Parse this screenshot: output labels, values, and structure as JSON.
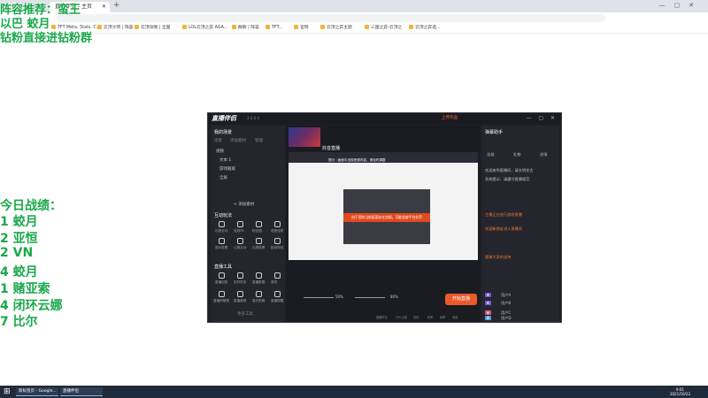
{
  "overlay": {
    "lineup_label": "阵容推荐：蛮王",
    "line2": "以巴 蛟月",
    "line3": "钻粉直接进钻粉群",
    "stats_title": "今日战绩：",
    "stats": [
      "1 蛟月",
      "2 亚恒",
      "2 VN",
      "4 蛟月",
      "1 赌亚索",
      "4 闭环云娜",
      "7 比尔"
    ]
  },
  "browser": {
    "tab_title": "直播伴侣 - 主页",
    "new_tab": "+",
    "window_controls": "—▢✕",
    "url": "",
    "bookmarks": [
      "TFT Meta, Stats, C...",
      "云顶大师 | 阵容",
      "云顶攻略 | 全国",
      "LOL云顶之弈 AGA...",
      "群聊 | 阵容",
      "TFT...",
      "官网",
      "云顶之弈主题",
      "三国之弈-云顶之",
      "云顶之弈选..."
    ]
  },
  "app": {
    "logo": "直播伴侣",
    "version": "3.5.0.0",
    "upload_badge": "上传作品",
    "window_controls": "— ▢ ✕",
    "left_panel": {
      "scene_header": "我的场景",
      "tabs": [
        "场景",
        "添加素材",
        "管理"
      ],
      "source_label": "添加素材",
      "sources": [
        "视频",
        "文本 1",
        "游戏截取",
        "全屏"
      ],
      "add_source_button": "+ 添加素材",
      "interact_header": "互动玩法",
      "interact_tools": [
        "礼物互动",
        "连线PK",
        "粉丝团",
        "语音连麦",
        "观众投票",
        "公屏互动",
        "礼物投票",
        "贴纸特效"
      ],
      "live_tools_header": "直播工具",
      "live_tools": [
        "直播回放",
        "定时任务",
        "直播数据",
        "音效",
        "直播间管理",
        "直播美颜",
        "高光剪辑",
        "直播提醒"
      ],
      "more_tools": "更多工具"
    },
    "center": {
      "streamer_name": "抖音直播",
      "alert_text": "提示 : 画面中出现违规内容，请及时调整",
      "error_banner": "由于您的当前画面存在违规，可能会被平台处罚",
      "mic_value": "50%",
      "volume_value": "80%",
      "start_live_button": "开始直播",
      "footer": [
        "直播时长",
        "CPU占用",
        "内存",
        "码率",
        "帧率",
        "丢帧"
      ]
    },
    "right_panel": {
      "header": "弹幕助手",
      "tabs": [
        "全部",
        "礼物",
        "进场"
      ],
      "messages": [
        "欢迎来到直播间，请文明发言",
        "系统提示：请遵守直播规范",
        "主播正在进行游戏直播",
        "欢迎新朋友进入直播间",
        "感谢大家的支持"
      ],
      "users": [
        "用户A",
        "用户B",
        "用户C",
        "用户D"
      ]
    }
  },
  "taskbar": {
    "start_icon": "⊞",
    "task1": "新标签页 - Google...",
    "task2": "直播伴侣",
    "time": "9:01",
    "date": "2021/10/22"
  },
  "colors": {
    "overlay_green": "#1aa84b",
    "app_bg": "#1e1f25",
    "accent_orange": "#ea5a2a"
  }
}
